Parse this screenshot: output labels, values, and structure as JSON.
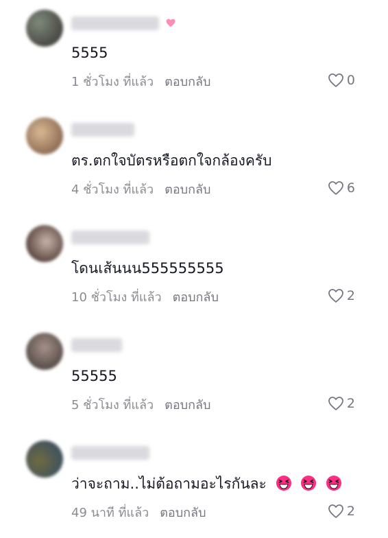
{
  "comments": [
    {
      "username": "",
      "text": "5555",
      "time": "1 ชั่วโมง ที่แล้ว",
      "reply_label": "ตอบกลับ",
      "likes": "0",
      "emojis": 0,
      "avatar_colors": [
        "#4a4a45",
        "#7f8a7b"
      ]
    },
    {
      "username": "",
      "text": "ตร.ตกใจบัตรหรือตกใจกล้องครับ",
      "time": "4 ชั่วโมง ที่แล้ว",
      "reply_label": "ตอบกลับ",
      "likes": "6",
      "emojis": 0,
      "avatar_colors": [
        "#c9a07a",
        "#8b6a52"
      ]
    },
    {
      "username": "",
      "text": "โดนเส้นนน555555555",
      "time": "10 ชั่วโมง ที่แล้ว",
      "reply_label": "ตอบกลับ",
      "likes": "2",
      "emojis": 0,
      "avatar_colors": [
        "#5e4a44",
        "#c7b3a6"
      ]
    },
    {
      "username": "",
      "text": "55555",
      "time": "5 ชั่วโมง ที่แล้ว",
      "reply_label": "ตอบกลับ",
      "likes": "2",
      "emojis": 0,
      "avatar_colors": [
        "#5b504c",
        "#a59189"
      ]
    },
    {
      "username": "",
      "text": "ว่าจะถาม..ไม่ต้อถามอะไรกันละ",
      "time": "49 นาที ที่แล้ว",
      "reply_label": "ตอบกลับ",
      "likes": "2",
      "emojis": 3,
      "avatar_colors": [
        "#6f6a40",
        "#3f5160"
      ]
    }
  ],
  "icons": {
    "like": "heart-outline-icon",
    "emoji": "laughing-squinting-face-emoji",
    "badge": "pink-heart-icon"
  },
  "colors": {
    "text_primary": "#161823",
    "text_secondary": "#8a8b91",
    "emoji_face": "#ff2d84",
    "badge_heart": "#ff8fb1"
  }
}
